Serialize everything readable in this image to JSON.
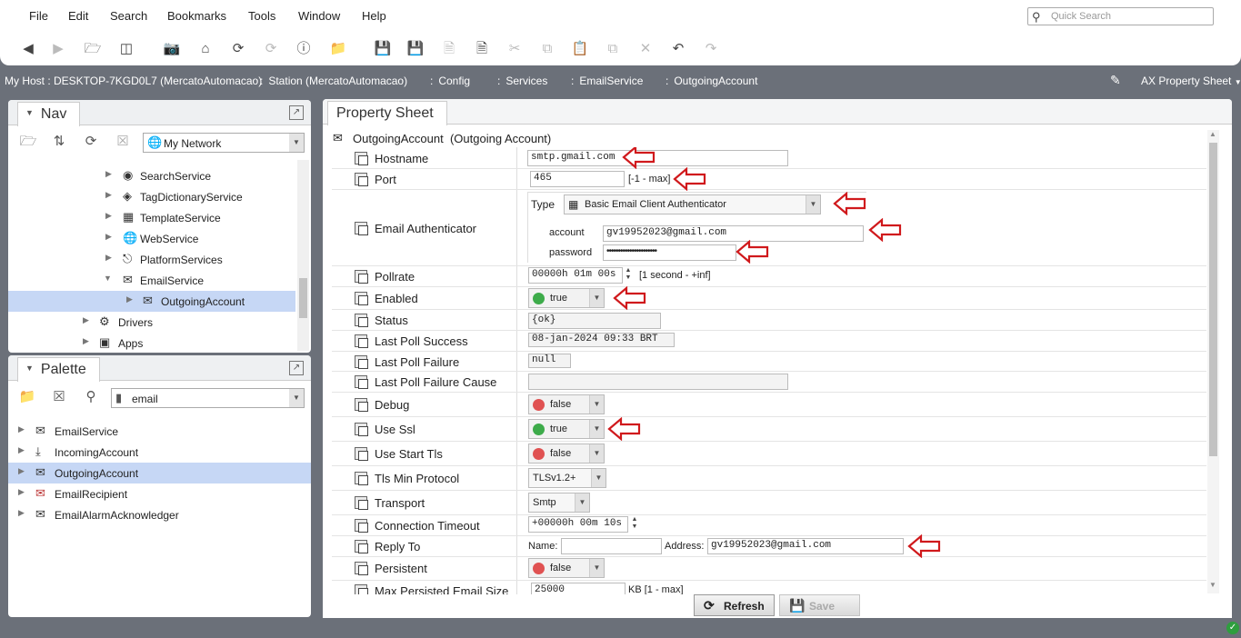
{
  "menu": [
    "File",
    "Edit",
    "Search",
    "Bookmarks",
    "Tools",
    "Window",
    "Help"
  ],
  "quick_search": {
    "placeholder": "Quick Search"
  },
  "breadcrumbs": [
    "My Host : DESKTOP-7KGD0L7 (MercatoAutomacao)",
    "Station (MercatoAutomacao)",
    "Config",
    "Services",
    "EmailService",
    "OutgoingAccount"
  ],
  "view_selector": "AX Property Sheet",
  "nav": {
    "title": "Nav",
    "root_selector": "My Network",
    "items": [
      {
        "label": "SearchService",
        "icon": "search-service-icon"
      },
      {
        "label": "TagDictionaryService",
        "icon": "tag-icon"
      },
      {
        "label": "TemplateService",
        "icon": "template-icon"
      },
      {
        "label": "WebService",
        "icon": "globe-icon"
      },
      {
        "label": "PlatformServices",
        "icon": "platform-icon"
      },
      {
        "label": "EmailService",
        "icon": "email-service-icon"
      },
      {
        "label": "OutgoingAccount",
        "icon": "outgoing-account-icon"
      },
      {
        "label": "Drivers",
        "icon": "drivers-icon"
      },
      {
        "label": "Apps",
        "icon": "apps-icon"
      }
    ]
  },
  "palette": {
    "title": "Palette",
    "module": "email",
    "items": [
      {
        "label": "EmailService"
      },
      {
        "label": "IncomingAccount"
      },
      {
        "label": "OutgoingAccount"
      },
      {
        "label": "EmailRecipient"
      },
      {
        "label": "EmailAlarmAcknowledger"
      }
    ]
  },
  "property_sheet": {
    "tab": "Property Sheet",
    "header": "OutgoingAccount  (Outgoing Account)",
    "labels": {
      "hostname": "Hostname",
      "port": "Port",
      "authenticator": "Email Authenticator",
      "pollrate": "Pollrate",
      "enabled": "Enabled",
      "status": "Status",
      "last_poll_success": "Last Poll Success",
      "last_poll_failure": "Last Poll Failure",
      "last_poll_failure_cause": "Last Poll Failure Cause",
      "debug": "Debug",
      "use_ssl": "Use Ssl",
      "use_start_tls": "Use Start Tls",
      "tls_min_protocol": "Tls Min Protocol",
      "transport": "Transport",
      "connection_timeout": "Connection Timeout",
      "reply_to": "Reply To",
      "persistent": "Persistent",
      "max_persisted": "Max Persisted Email Size"
    },
    "values": {
      "hostname": "smtp.gmail.com",
      "port": "465",
      "port_range": "[-1 - max]",
      "auth_type_label": "Type",
      "auth_type": "Basic Email Client Authenticator",
      "account_label": "account",
      "account": "gv19952023@gmail.com",
      "password_label": "password",
      "password": "••••••••••••••••••••••",
      "pollrate": "00000h 01m 00s",
      "pollrate_range": "[1 second - +inf]",
      "enabled": "true",
      "status": "{ok}",
      "last_poll_success": "08-jan-2024 09:33 BRT",
      "last_poll_failure": "null",
      "last_poll_failure_cause": "",
      "debug": "false",
      "use_ssl": "true",
      "use_start_tls": "false",
      "tls_min_protocol": "TLSv1.2+",
      "transport": "Smtp",
      "connection_timeout": "+00000h 00m 10s",
      "reply_name_label": "Name:",
      "reply_name": "",
      "reply_address_label": "Address:",
      "reply_address": "gv19952023@gmail.com",
      "persistent": "false",
      "max_persisted": "25000",
      "max_persisted_unit": "KB [1 - max]"
    },
    "colors": {
      "true": "#3dab4a",
      "false": "#e05252",
      "annotation": "#d0191c"
    }
  },
  "buttons": {
    "refresh": "Refresh",
    "save": "Save"
  }
}
